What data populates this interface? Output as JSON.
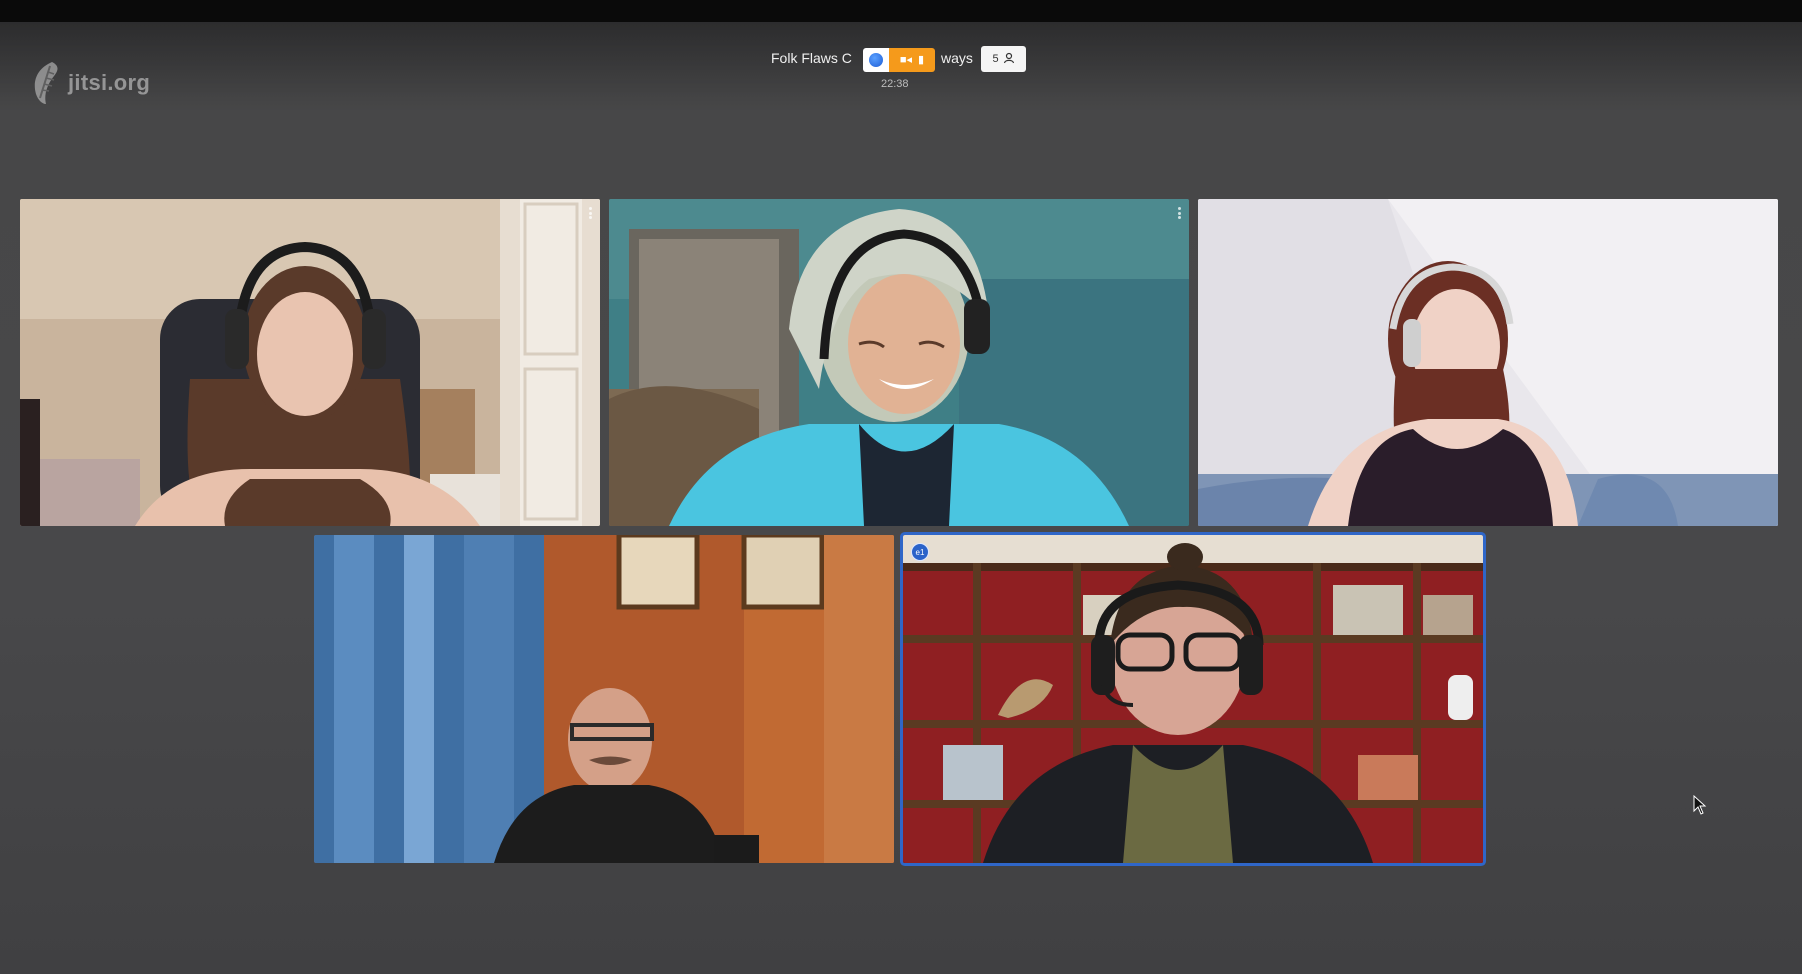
{
  "app": {
    "logo_text": "jitsi.org",
    "logo_icon": "jitsi-leaf-icon"
  },
  "conference": {
    "title_left": "Folk Flaws C",
    "title_right": "ways",
    "timer": "22:38",
    "recording_icon": "recording-dot-icon",
    "media_icons": [
      "camera-icon",
      "microphone-icon"
    ],
    "participant_count": "5",
    "participants_icon": "participants-icon"
  },
  "tiles": [
    {
      "id": "tile-1",
      "has_menu": true
    },
    {
      "id": "tile-2",
      "has_menu": true
    },
    {
      "id": "tile-3",
      "has_menu": false
    },
    {
      "id": "tile-4",
      "has_menu": false
    },
    {
      "id": "tile-5",
      "has_menu": false,
      "dominant_speaker": true,
      "badge_text": "e1"
    }
  ],
  "colors": {
    "accent_blue": "#2f66c8",
    "rec_orange": "#f59a1b",
    "stage_gray": "#48484a"
  }
}
